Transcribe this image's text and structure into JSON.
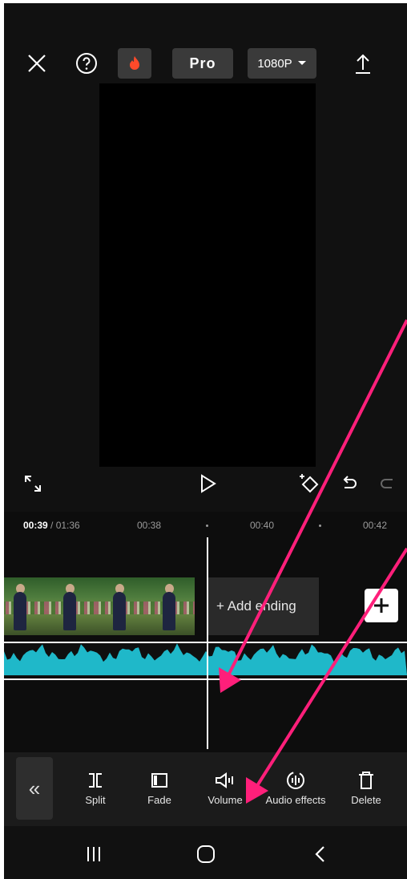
{
  "topbar": {
    "close_icon": "close-icon",
    "help_icon": "help-icon",
    "fire_icon": "fire-icon",
    "pro_label": "Pro",
    "resolution_label": "1080P",
    "export_icon": "export-icon"
  },
  "controls": {
    "fullscreen_icon": "fullscreen-icon",
    "play_icon": "play-icon",
    "keyframe_icon": "keyframe-icon",
    "undo_icon": "undo-icon",
    "redo_icon": "redo-icon"
  },
  "ruler": {
    "current_time": "00:39",
    "total_time": " / 01:36",
    "ticks": [
      "00:38",
      "00:40",
      "00:42"
    ]
  },
  "timeline": {
    "add_ending_label": "+ Add ending",
    "add_clip_icon": "plus-icon"
  },
  "toolbar": {
    "items": [
      {
        "label": "Split",
        "icon": "split-icon"
      },
      {
        "label": "Fade",
        "icon": "fade-icon"
      },
      {
        "label": "Volume",
        "icon": "volume-icon"
      },
      {
        "label": "Audio effects",
        "icon": "audio-effects-icon"
      },
      {
        "label": "Delete",
        "icon": "delete-icon"
      }
    ]
  },
  "colors": {
    "waveform": "#1fb8c9",
    "annotation_arrow": "#ff1f7a",
    "fire": "#ff4a2a"
  }
}
